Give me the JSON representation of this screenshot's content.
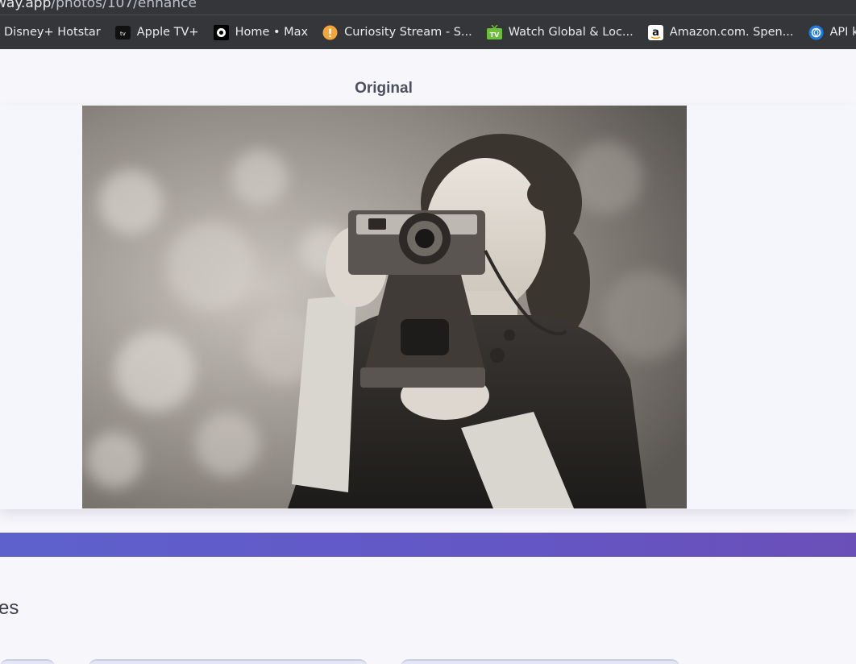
{
  "browser": {
    "url_host": "way.app",
    "url_path": "/photos/107/enhance",
    "bookmarks": [
      {
        "label": "Disney+ Hotstar",
        "icon": "none"
      },
      {
        "label": "Apple TV+",
        "icon": "apple-tv-icon"
      },
      {
        "label": "Home • Max",
        "icon": "max-icon"
      },
      {
        "label": "Curiosity Stream - S...",
        "icon": "curiosity-stream-icon"
      },
      {
        "label": "Watch Global & Loc...",
        "icon": "tv-icon"
      },
      {
        "label": "Amazon.com. Spen...",
        "icon": "amazon-icon"
      },
      {
        "label": "API keys - O",
        "icon": "openai-icon"
      }
    ]
  },
  "comparison": {
    "original_label": "Original"
  },
  "section": {
    "heading_fragment": "es"
  },
  "colors": {
    "accent_band_start": "#5e61cc",
    "accent_band_end": "#6a4fb8",
    "page_bg": "#f7f7fb",
    "chrome_bg": "#35363a"
  }
}
